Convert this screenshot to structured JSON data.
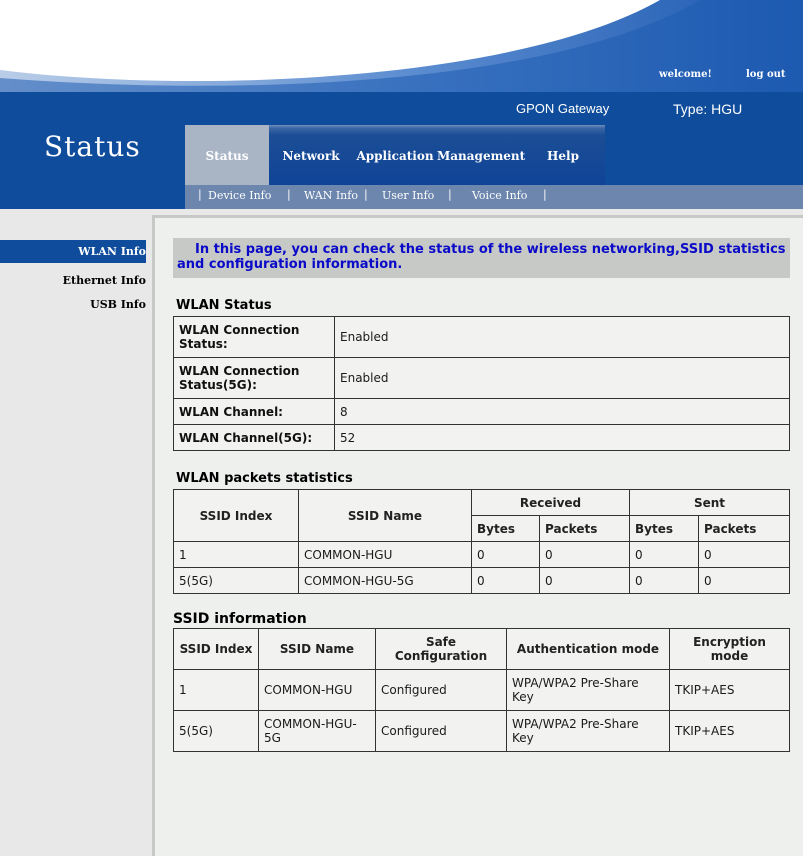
{
  "top": {
    "welcome_label": "welcome!",
    "logout_label": "log out"
  },
  "header": {
    "page_title": "Status",
    "gateway_label": "GPON Gateway",
    "type_label": "Type: HGU",
    "tabs": [
      {
        "label": "Status"
      },
      {
        "label": "Network"
      },
      {
        "label": "Application"
      },
      {
        "label": "Management"
      },
      {
        "label": "Help"
      }
    ],
    "subnav": [
      {
        "label": "Device Info"
      },
      {
        "label": "WAN Info"
      },
      {
        "label": "User Info"
      },
      {
        "label": "Voice Info"
      }
    ],
    "separator": "|"
  },
  "sidebar": {
    "items": [
      {
        "label": "WLAN Info"
      },
      {
        "label": "Ethernet Info"
      },
      {
        "label": "USB Info"
      }
    ]
  },
  "intro_text": "In this page, you can check the status of the wireless networking,SSID statistics and configuration information.",
  "wlan_status": {
    "title": "WLAN Status",
    "rows": [
      {
        "label": "WLAN Connection Status:",
        "value": "Enabled"
      },
      {
        "label": "WLAN Connection Status(5G):",
        "value": "Enabled"
      },
      {
        "label": "WLAN Channel:",
        "value": "8"
      },
      {
        "label": "WLAN Channel(5G):",
        "value": "52"
      }
    ]
  },
  "packets": {
    "title": "WLAN packets statistics",
    "headers": {
      "ssid_index": "SSID Index",
      "ssid_name": "SSID Name",
      "received": "Received",
      "sent": "Sent",
      "bytes": "Bytes",
      "packets": "Packets"
    },
    "rows": [
      {
        "index": "1",
        "name": "COMMON-HGU",
        "rx_bytes": "0",
        "rx_packets": "0",
        "tx_bytes": "0",
        "tx_packets": "0"
      },
      {
        "index": "5(5G)",
        "name": "COMMON-HGU-5G",
        "rx_bytes": "0",
        "rx_packets": "0",
        "tx_bytes": "0",
        "tx_packets": "0"
      }
    ]
  },
  "ssid_info": {
    "title": "SSID information",
    "headers": {
      "index": "SSID Index",
      "name": "SSID Name",
      "safe": "Safe Configuration",
      "auth": "Authentication mode",
      "enc": "Encryption mode"
    },
    "rows": [
      {
        "index": "1",
        "name": "COMMON-HGU",
        "safe": "Configured",
        "auth": "WPA/WPA2 Pre-Share Key",
        "enc": "TKIP+AES"
      },
      {
        "index": "5(5G)",
        "name": "COMMON-HGU-5G",
        "safe": "Configured",
        "auth": "WPA/WPA2 Pre-Share Key",
        "enc": "TKIP+AES"
      }
    ]
  },
  "colors": {
    "header_blue": "#0f4d9c",
    "intro_text": "#0a0ac8"
  }
}
